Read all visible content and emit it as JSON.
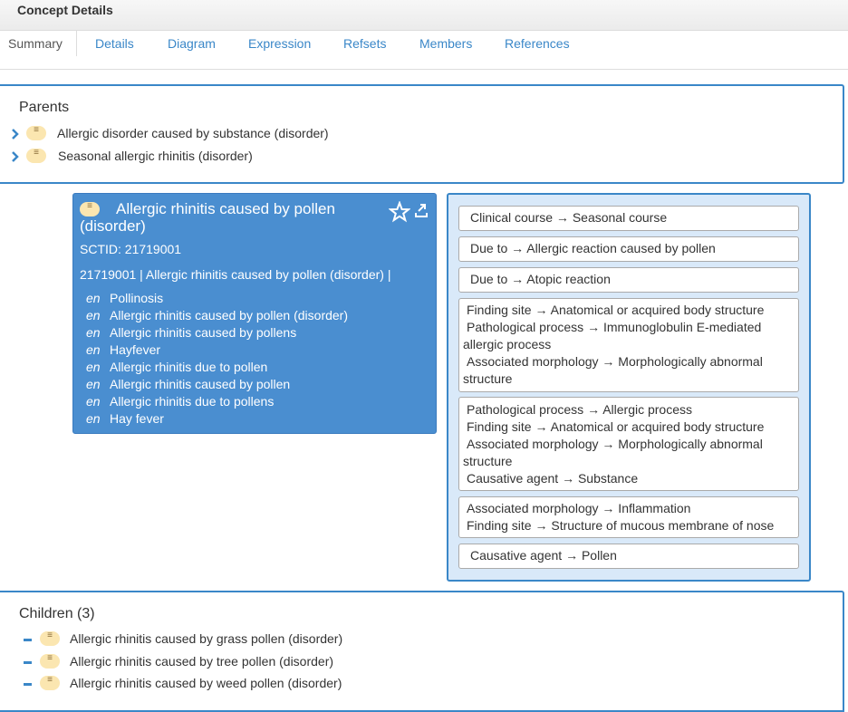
{
  "header": {
    "title": "Concept Details"
  },
  "tabs": [
    "Summary",
    "Details",
    "Diagram",
    "Expression",
    "Refsets",
    "Members",
    "References"
  ],
  "parents": {
    "title": "Parents",
    "items": [
      "Allergic disorder caused by substance (disorder)",
      "Seasonal allergic rhinitis (disorder)"
    ]
  },
  "concept": {
    "title": "Allergic rhinitis caused by pollen (disorder)",
    "sctid": "SCTID: 21719001",
    "fsn": "21719001 | Allergic rhinitis caused by pollen (disorder) |",
    "descriptions": [
      {
        "lang": "en",
        "term": "Pollinosis"
      },
      {
        "lang": "en",
        "term": "Allergic rhinitis caused by pollen (disorder)"
      },
      {
        "lang": "en",
        "term": "Allergic rhinitis caused by pollens"
      },
      {
        "lang": "en",
        "term": "Hayfever"
      },
      {
        "lang": "en",
        "term": "Allergic rhinitis due to pollen"
      },
      {
        "lang": "en",
        "term": "Allergic rhinitis caused by pollen"
      },
      {
        "lang": "en",
        "term": "Allergic rhinitis due to pollens"
      },
      {
        "lang": "en",
        "term": "Hay fever"
      }
    ]
  },
  "attributes": [
    [
      "Clinical course →  Seasonal course"
    ],
    [
      "Due to → Allergic reaction caused by pollen"
    ],
    [
      "Due to → Atopic reaction"
    ],
    [
      " Finding site →  Anatomical or acquired body structure",
      " Pathological process →  Immunoglobulin E-mediated",
      "allergic process",
      " Associated morphology →  Morphologically abnormal",
      "structure"
    ],
    [
      " Pathological process → Allergic process",
      " Finding site → Anatomical or acquired body structure",
      " Associated morphology →  Morphologically abnormal",
      "structure",
      " Causative agent →  Substance"
    ],
    [
      " Associated morphology →  Inflammation",
      " Finding site →  Structure of mucous membrane of nose"
    ],
    [
      "Causative agent →  Pollen"
    ]
  ],
  "children": {
    "title": "Children (3)",
    "items": [
      "Allergic rhinitis caused by grass pollen (disorder)",
      "Allergic rhinitis caused by tree pollen (disorder)",
      "Allergic rhinitis caused by weed pollen (disorder)"
    ]
  },
  "icons": {
    "expand": "chevron-right-icon",
    "badge": "primitive-concept-badge",
    "favorite": "star-icon",
    "export": "export-icon"
  }
}
